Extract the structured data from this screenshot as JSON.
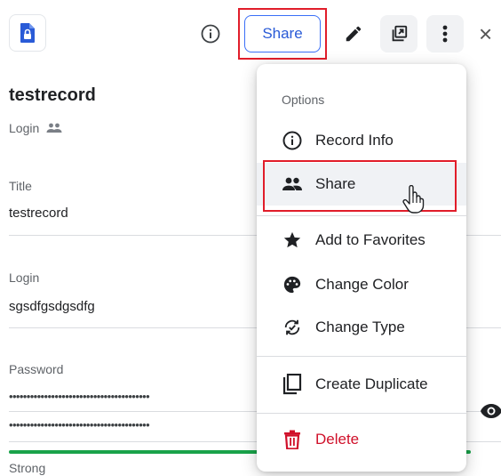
{
  "toolbar": {
    "share_label": "Share",
    "icons": [
      "record-lock-icon",
      "info-icon",
      "edit-icon",
      "duplicate-icon",
      "more-vert-icon",
      "close-icon"
    ],
    "close_glyph": "×"
  },
  "record": {
    "title": "testrecord",
    "type_label": "Login"
  },
  "fields": [
    {
      "label": "Title",
      "value": "testrecord"
    },
    {
      "label": "Login",
      "value": "sgsdfgsdgsdfg"
    },
    {
      "label": "Password",
      "value_masked_1": "••••••••••••••••••••••••••••••••••••••••",
      "value_masked_2": "••••••••••••••••••••••••••••••••••••••••"
    }
  ],
  "password_strength": "Strong",
  "menu": {
    "header": "Options",
    "items": [
      {
        "label": "Record Info",
        "icon": "info-icon"
      },
      {
        "label": "Share",
        "icon": "people-icon"
      },
      {
        "label": "Add to Favorites",
        "icon": "star-icon"
      },
      {
        "label": "Change Color",
        "icon": "palette-icon"
      },
      {
        "label": "Change Type",
        "icon": "change-type-icon"
      },
      {
        "label": "Create Duplicate",
        "icon": "copy-icon"
      },
      {
        "label": "Delete",
        "icon": "trash-icon"
      }
    ]
  },
  "colors": {
    "accent": "#3a6ff7",
    "highlight": "#e11d2a",
    "danger": "#d0102a",
    "strength": "#19a34a"
  }
}
